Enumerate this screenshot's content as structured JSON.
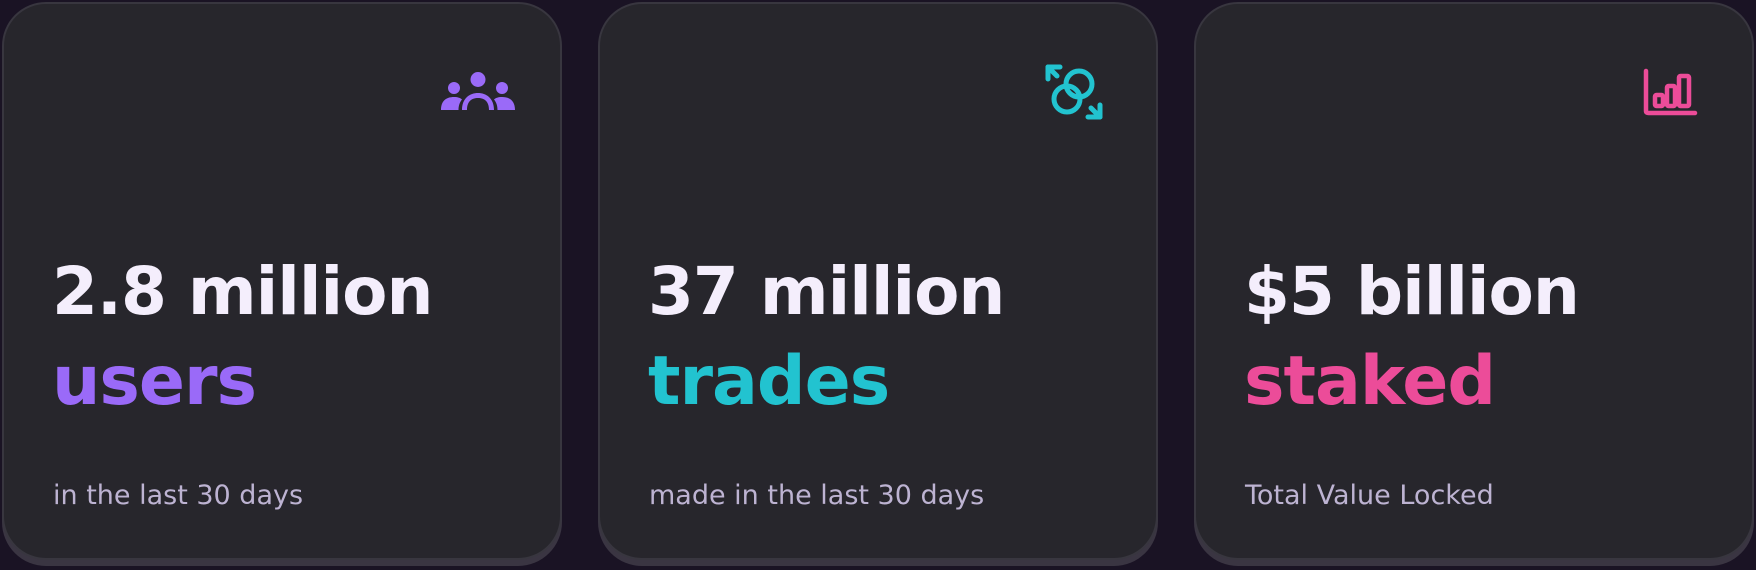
{
  "colors": {
    "users_accent": "#9a6af8",
    "trades_accent": "#22c3d0",
    "staked_accent": "#ec4c99",
    "value_text": "#f4eefc",
    "caption_text": "#bdb3d2",
    "card_background": "#27262c",
    "page_background": "#1a1324"
  },
  "stats": [
    {
      "value": "2.8 million",
      "noun": "users",
      "caption": "in the last 30 days",
      "icon": "users-group-icon"
    },
    {
      "value": "37 million",
      "noun": "trades",
      "caption": "made in the last 30 days",
      "icon": "trade-swap-icon"
    },
    {
      "value": "$5 billion",
      "noun": "staked",
      "caption": "Total Value Locked",
      "icon": "bar-chart-icon"
    }
  ]
}
